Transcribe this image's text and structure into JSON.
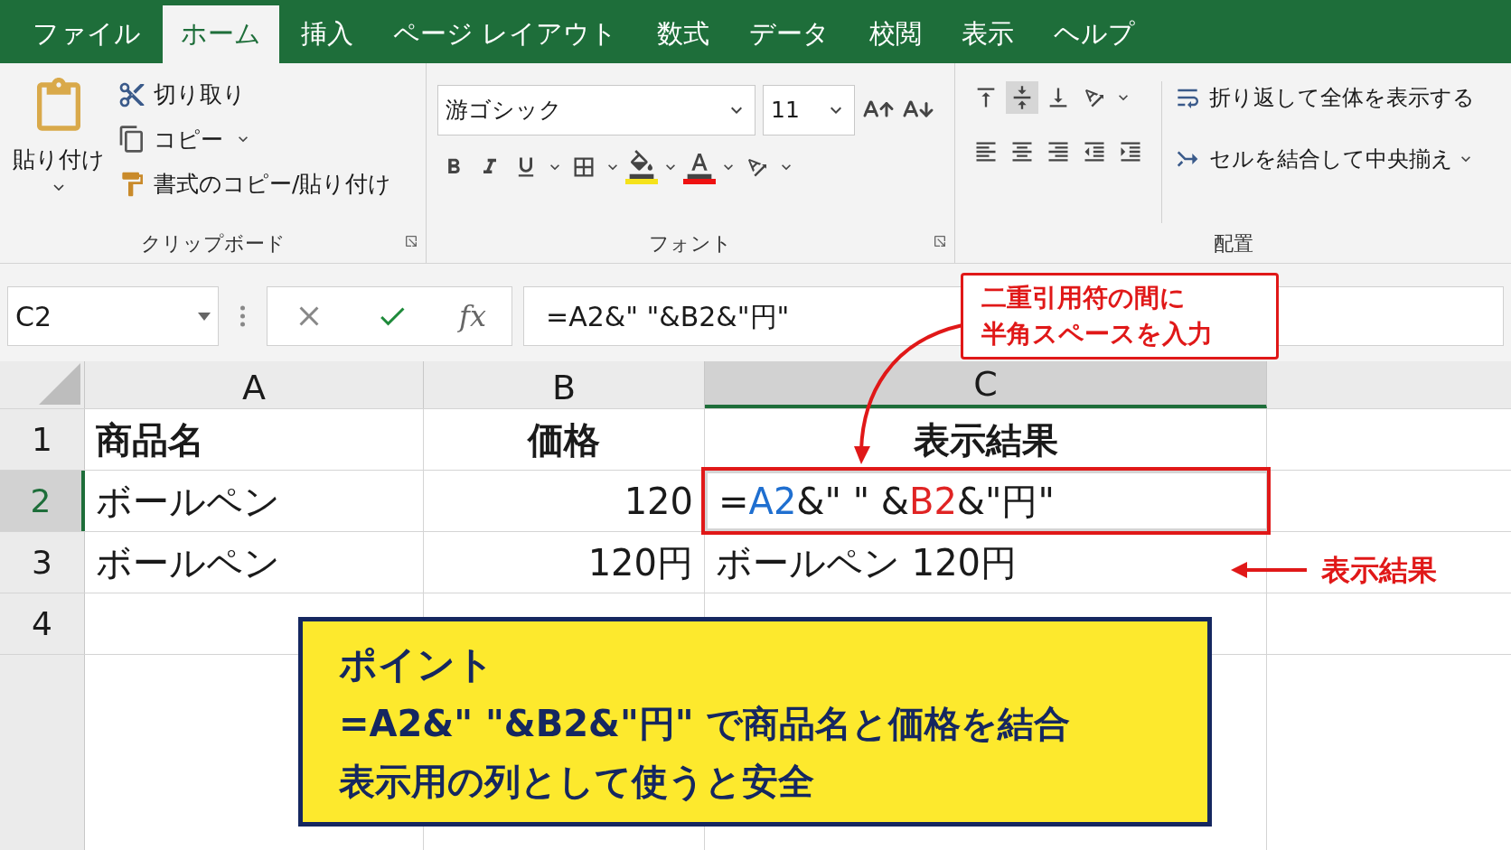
{
  "tabs": [
    {
      "label": "ファイル",
      "selected": false
    },
    {
      "label": "ホーム",
      "selected": true
    },
    {
      "label": "挿入",
      "selected": false
    },
    {
      "label": "ページ レイアウト",
      "selected": false
    },
    {
      "label": "数式",
      "selected": false
    },
    {
      "label": "データ",
      "selected": false
    },
    {
      "label": "校閲",
      "selected": false
    },
    {
      "label": "表示",
      "selected": false
    },
    {
      "label": "ヘルプ",
      "selected": false
    }
  ],
  "clipboard": {
    "paste": "貼り付け",
    "cut": "切り取り",
    "copy": "コピー",
    "format_painter": "書式のコピー/貼り付け",
    "label": "クリップボード"
  },
  "font": {
    "name": "游ゴシック",
    "size": "11",
    "label": "フォント"
  },
  "alignment": {
    "wrap_text": "折り返して全体を表示する",
    "merge_center": "セルを結合して中央揃え",
    "label": "配置"
  },
  "formula_bar": {
    "name_box": "C2",
    "fx": "fx",
    "formula": "=A2&\" \"&B2&\"円\""
  },
  "columns": [
    {
      "label": "A",
      "selected": false
    },
    {
      "label": "B",
      "selected": false
    },
    {
      "label": "C",
      "selected": true
    }
  ],
  "rows": [
    {
      "number": "1",
      "selected": false,
      "cells": [
        {
          "kind": "header",
          "text": "商品名"
        },
        {
          "kind": "header",
          "text": "価格"
        },
        {
          "kind": "header",
          "text": "表示結果"
        }
      ]
    },
    {
      "number": "2",
      "selected": true,
      "cells": [
        {
          "kind": "text",
          "text": "ボールペン"
        },
        {
          "kind": "number",
          "text": "120"
        },
        {
          "kind": "formula",
          "segments": [
            {
              "text": "=",
              "color": "#1a1a1a"
            },
            {
              "text": "A2",
              "color": "#1f6fd0"
            },
            {
              "text": "&\" \" &",
              "color": "#1a1a1a"
            },
            {
              "text": "B2",
              "color": "#e02424"
            },
            {
              "text": "&\"円\"",
              "color": "#1a1a1a"
            }
          ]
        }
      ]
    },
    {
      "number": "3",
      "selected": false,
      "cells": [
        {
          "kind": "text",
          "text": "ボールペン"
        },
        {
          "kind": "number",
          "text": "120円"
        },
        {
          "kind": "text",
          "text": "ボールペン  120円"
        }
      ]
    },
    {
      "number": "4",
      "selected": false,
      "cells": []
    }
  ],
  "callout": {
    "lines": [
      "二重引用符の間に",
      "半角スペースを入力"
    ]
  },
  "result_note": "表示結果",
  "point": {
    "title": "ポイント",
    "lines": [
      "=A2&\" \"&B2&\"円\" で商品名と価格を結合",
      "表示用の列として使うと安全"
    ]
  }
}
